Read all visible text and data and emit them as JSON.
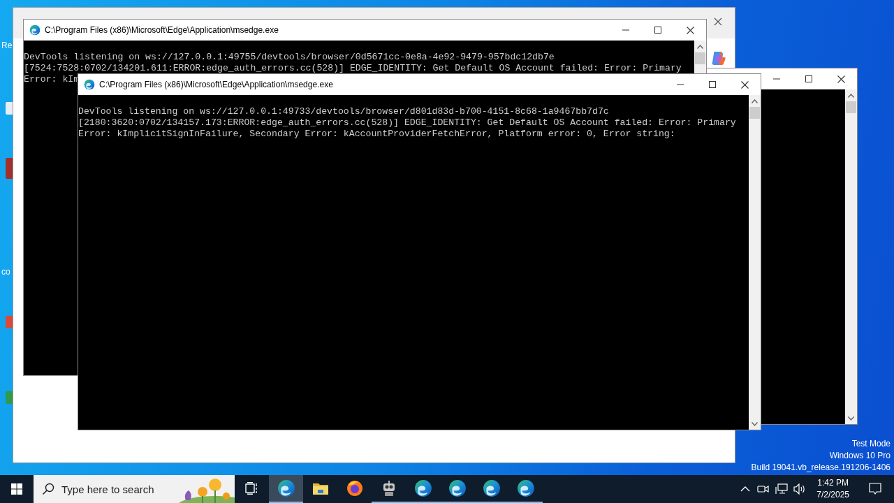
{
  "desktop": {
    "icon_labels": [
      "Re",
      "co"
    ],
    "system_notice": [
      "Test Mode",
      "Windows 10 Pro",
      "Build 19041.vb_release.191206-1406"
    ]
  },
  "windows": [
    {
      "kind": "browser"
    },
    {
      "kind": "console"
    },
    {
      "kind": "console",
      "title": "C:\\Program Files (x86)\\Microsoft\\Edge\\Application\\msedge.exe",
      "lines": [
        "DevTools listening on ws://127.0.0.1:49755/devtools/browser/0d5671cc-0e8a-4e92-9479-957bdc12db7e",
        "[7524:7528:0702/134201.611:ERROR:edge_auth_errors.cc(528)] EDGE_IDENTITY: Get Default OS Account failed: Error: Primary",
        "Error: kIm"
      ]
    },
    {
      "kind": "console",
      "title": "C:\\Program Files (x86)\\Microsoft\\Edge\\Application\\msedge.exe",
      "lines": [
        "DevTools listening on ws://127.0.0.1:49733/devtools/browser/d801d83d-b700-4151-8c68-1a9467bb7d7c",
        "[2180:3620:0702/134157.173:ERROR:edge_auth_errors.cc(528)] EDGE_IDENTITY: Get Default OS Account failed: Error: Primary",
        "Error: kImplicitSignInFailure, Secondary Error: kAccountProviderFetchError, Platform error: 0, Error string:"
      ]
    }
  ],
  "taskbar": {
    "search": {
      "placeholder": "Type here to search"
    },
    "apps": [
      {
        "kind": "task-view",
        "running": false,
        "selected": false
      },
      {
        "kind": "edge",
        "running": true,
        "selected": true
      },
      {
        "kind": "folder",
        "running": false,
        "selected": false
      },
      {
        "kind": "firefox",
        "running": false,
        "selected": false
      },
      {
        "kind": "robot",
        "running": true,
        "selected": false
      },
      {
        "kind": "edge",
        "running": true,
        "selected": false
      },
      {
        "kind": "edge",
        "running": true,
        "selected": false
      },
      {
        "kind": "edge",
        "running": true,
        "selected": false
      },
      {
        "kind": "edge",
        "running": true,
        "selected": false
      }
    ],
    "clock": {
      "time": "1:42 PM",
      "date": "7/2/2025"
    }
  }
}
